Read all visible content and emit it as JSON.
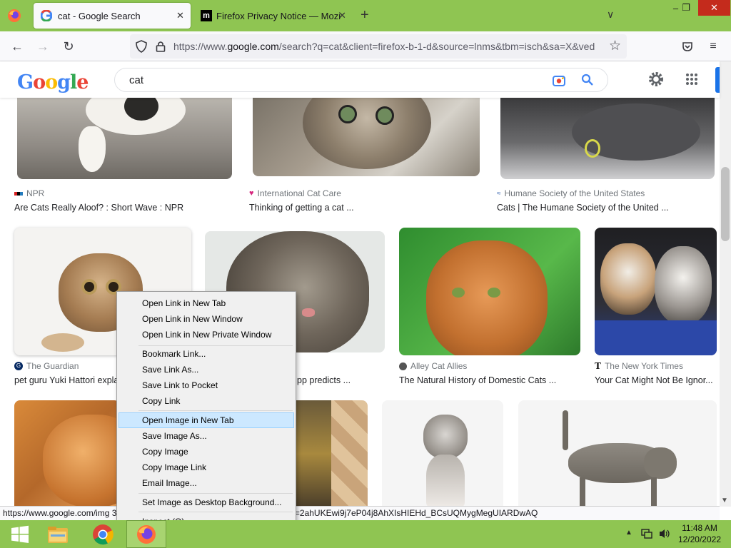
{
  "browser": {
    "tabs": [
      {
        "label": "cat - Google Search",
        "active": true,
        "icon": "google-g-icon"
      },
      {
        "label": "Firefox Privacy Notice — Mozilla",
        "active": false,
        "icon": "mozilla-m-icon"
      }
    ],
    "url_prefix": "https://www.",
    "url_domain": "google.com",
    "url_rest": "/search?q=cat&client=firefox-b-1-d&source=lnms&tbm=isch&sa=X&ved",
    "status_url": "https://www.google.com/img                                                   392d05302e...0&q=cat&client=firefox-b-1-d&ved=2ahUKEwi9j7eP04j8AhXIsHIEHd_BCsUQMygMegUIARDwAQ"
  },
  "google": {
    "logo_letters": [
      "G",
      "o",
      "o",
      "g",
      "l",
      "e"
    ],
    "search_value": "cat"
  },
  "results": [
    {
      "source": "NPR",
      "title": "Are Cats Really Aloof? : Short Wave : NPR"
    },
    {
      "source": "International Cat Care",
      "title": "Thinking of getting a cat ..."
    },
    {
      "source": "Humane Society of the United States",
      "title": "Cats | The Humane Society of the United ..."
    },
    {
      "source": "The Guardian",
      "title": "pet guru Yuki Hattori expla"
    },
    {
      "source": "",
      "title": "pp predicts ..."
    },
    {
      "source": "Alley Cat Allies",
      "title": "The Natural History of Domestic Cats ..."
    },
    {
      "source": "The New York Times",
      "title": "Your Cat Might Not Be Ignor..."
    }
  ],
  "context_menu": [
    {
      "label": "Open Link in New Tab",
      "highlight": false
    },
    {
      "label": "Open Link in New Window",
      "highlight": false
    },
    {
      "label": "Open Link in New Private Window",
      "highlight": false
    },
    {
      "label": "Bookmark Link...",
      "highlight": false
    },
    {
      "label": "Save Link As...",
      "highlight": false
    },
    {
      "label": "Save Link to Pocket",
      "highlight": false
    },
    {
      "label": "Copy Link",
      "highlight": false
    },
    {
      "label": "Open Image in New Tab",
      "highlight": true
    },
    {
      "label": "Save Image As...",
      "highlight": false
    },
    {
      "label": "Copy Image",
      "highlight": false
    },
    {
      "label": "Copy Image Link",
      "highlight": false
    },
    {
      "label": "Email Image...",
      "highlight": false
    },
    {
      "label": "Set Image as Desktop Background...",
      "highlight": false
    },
    {
      "label": "Inspect (Q)",
      "highlight": false
    }
  ],
  "taskbar": {
    "time": "11:48 AM",
    "date": "12/20/2022"
  },
  "colors": {
    "accent_green": "#8fc552",
    "menu_highlight": "#cce8ff",
    "google_blue": "#4285f4"
  }
}
